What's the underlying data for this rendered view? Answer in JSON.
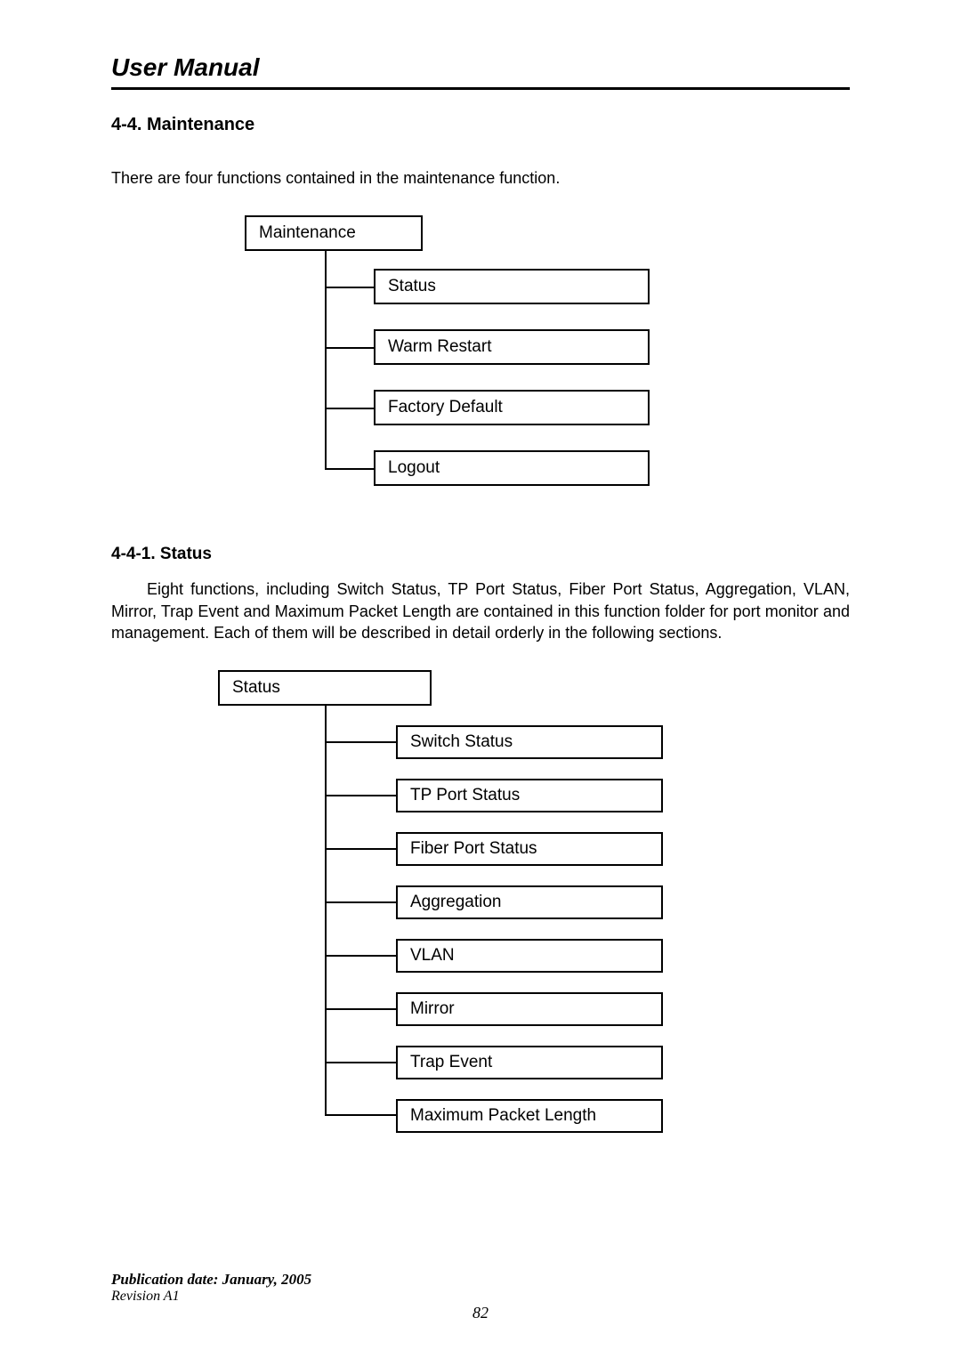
{
  "doc_title": "User Manual",
  "section": {
    "heading": "4-4. Maintenance",
    "intro": "There are four functions contained in the maintenance function."
  },
  "diagram1": {
    "root": "Maintenance",
    "children": [
      "Status",
      "Warm Restart",
      "Factory Default",
      "Logout"
    ]
  },
  "subsection": {
    "heading": "4-4-1. Status",
    "para": "Eight functions, including Switch Status, TP Port Status, Fiber Port Status, Aggregation, VLAN, Mirror, Trap Event and Maximum Packet Length are contained in this function folder for port monitor and management. Each of them will be described in detail orderly in the following sections."
  },
  "diagram2": {
    "root": "Status",
    "children": [
      "Switch Status",
      "TP Port Status",
      "Fiber Port Status",
      "Aggregation",
      "VLAN",
      "Mirror",
      "Trap Event",
      "Maximum Packet Length"
    ]
  },
  "footer": {
    "pub_date": "Publication date: January, 2005",
    "revision": "Revision A1",
    "page": "82"
  }
}
